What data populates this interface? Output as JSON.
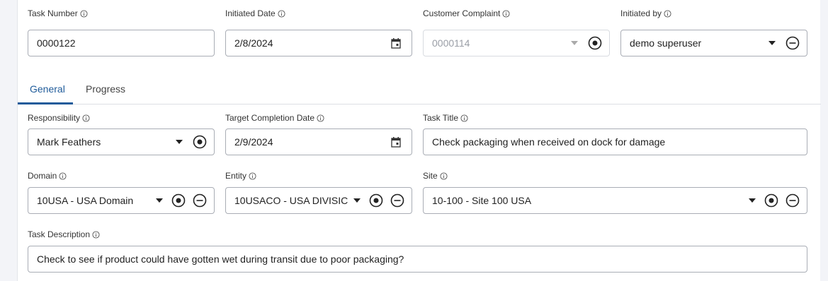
{
  "fields": {
    "task_number": {
      "label": "Task Number",
      "value": "0000122"
    },
    "initiated_date": {
      "label": "Initiated Date",
      "value": "2/8/2024"
    },
    "customer_complaint": {
      "label": "Customer Complaint",
      "value": "0000114"
    },
    "initiated_by": {
      "label": "Initiated by",
      "value": "demo superuser"
    },
    "responsibility": {
      "label": "Responsibility",
      "value": "Mark Feathers"
    },
    "target_completion_date": {
      "label": "Target Completion Date",
      "value": "2/9/2024"
    },
    "task_title": {
      "label": "Task Title",
      "value": "Check packaging when received on dock for damage"
    },
    "domain": {
      "label": "Domain",
      "value": "10USA - USA Domain"
    },
    "entity": {
      "label": "Entity",
      "value": "10USACO - USA DIVISIC"
    },
    "site": {
      "label": "Site",
      "value": "10-100 - Site 100 USA"
    },
    "task_description": {
      "label": "Task Description",
      "value": "Check to see if product could have gotten wet during transit due to poor packaging?"
    }
  },
  "tabs": [
    {
      "label": "General",
      "active": true
    },
    {
      "label": "Progress",
      "active": false
    }
  ],
  "icons": {
    "info": "info-icon",
    "dropdown": "chevron-down-icon",
    "select": "radio-target-icon",
    "clear": "minus-circle-icon",
    "calendar": "calendar-icon"
  },
  "colors": {
    "accent": "#1f5b9a",
    "border": "#a9adb5",
    "disabled_text": "#9a9ea6",
    "page_background": "#f3f4f8"
  }
}
